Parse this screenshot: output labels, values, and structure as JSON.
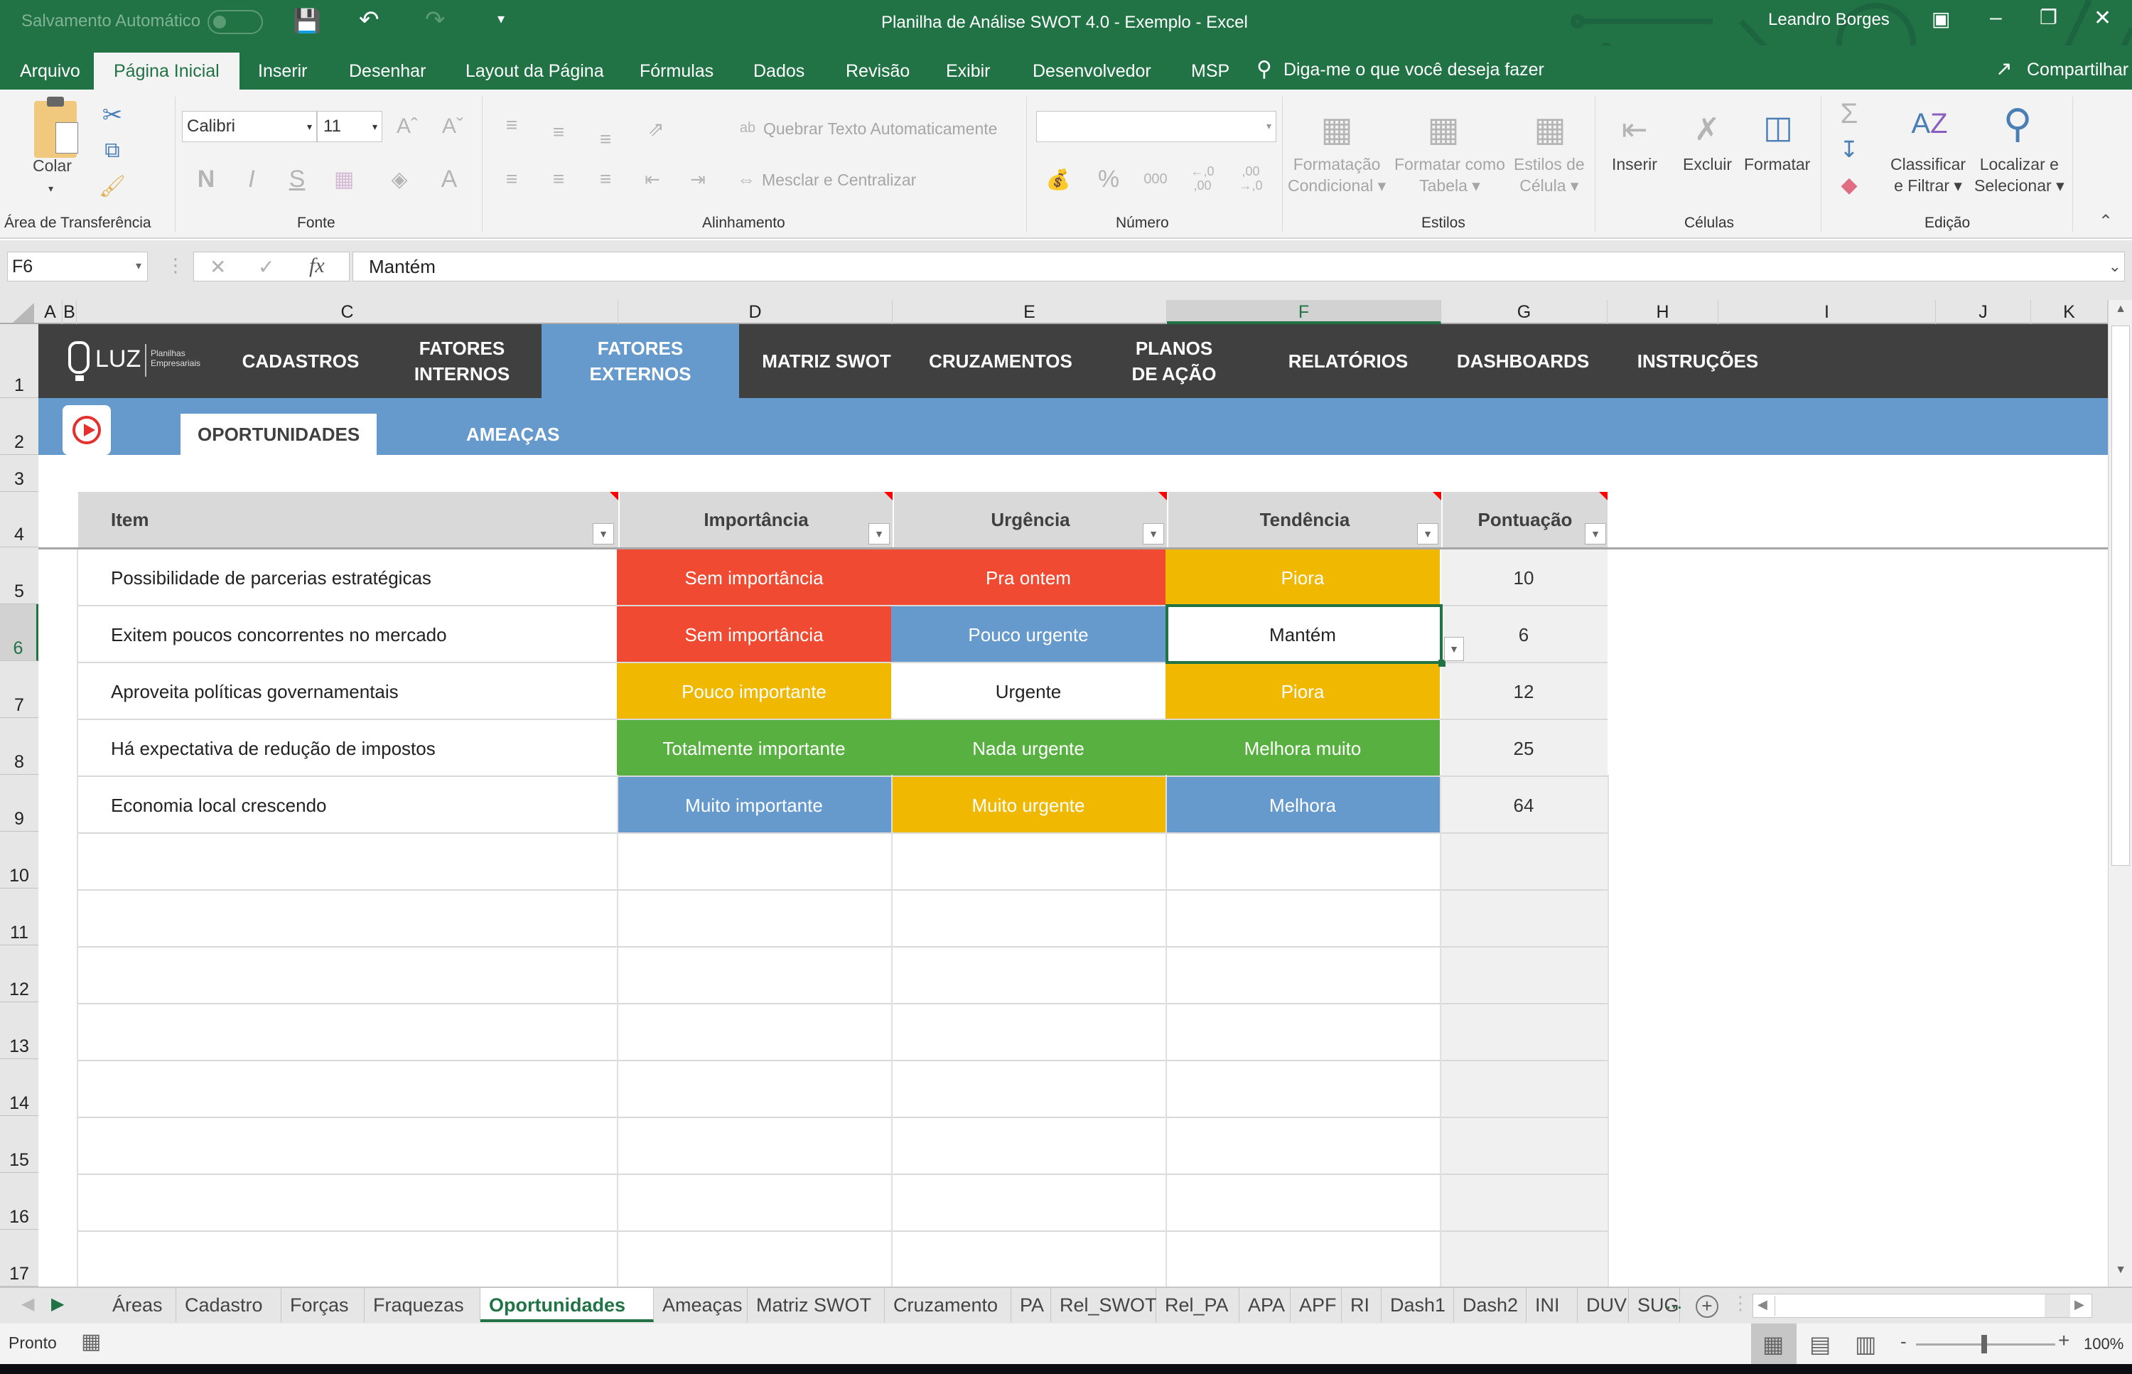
{
  "titlebar": {
    "autosave_label": "Salvamento Automático",
    "autosave_state": "off",
    "title": "Planilha de Análise SWOT 4.0 - Exemplo  -  Excel",
    "user": "Leandro Borges"
  },
  "ribbon_tabs": [
    "Arquivo",
    "Página Inicial",
    "Inserir",
    "Desenhar",
    "Layout da Página",
    "Fórmulas",
    "Dados",
    "Revisão",
    "Exibir",
    "Desenvolvedor",
    "MSP"
  ],
  "ribbon_active_tab": "Página Inicial",
  "tell_me": "Diga-me o que você deseja fazer",
  "share": "Compartilhar",
  "ribbon": {
    "clipboard": {
      "paste": "Colar",
      "label": "Área de Transferência"
    },
    "font": {
      "name": "Calibri",
      "size": "11",
      "bold": "N",
      "italic": "I",
      "underline": "S",
      "label": "Fonte"
    },
    "alignment": {
      "wrap": "Quebrar Texto Automaticamente",
      "merge": "Mesclar e Centralizar",
      "label": "Alinhamento"
    },
    "number": {
      "format": "",
      "percent": "%",
      "thousands": "000",
      "inc_dec": "←,0 ,00",
      "dec_dec": ",00 →,0",
      "label": "Número"
    },
    "styles": {
      "conditional": [
        "Formatação",
        "Condicional"
      ],
      "table": [
        "Formatar como",
        "Tabela"
      ],
      "cell": [
        "Estilos de",
        "Célula"
      ],
      "label": "Estilos"
    },
    "cells": {
      "insert": "Inserir",
      "delete": "Excluir",
      "format": "Formatar",
      "label": "Células"
    },
    "editing": {
      "sort": [
        "Classificar",
        "e Filtrar"
      ],
      "find": [
        "Localizar e",
        "Selecionar"
      ],
      "label": "Edição"
    }
  },
  "formula_bar": {
    "name_box": "F6",
    "fx": "fx",
    "value": "Mantém"
  },
  "columns": [
    "A",
    "B",
    "C",
    "D",
    "E",
    "F",
    "G",
    "H",
    "I",
    "J",
    "K"
  ],
  "selected_column": "F",
  "rows": [
    "1",
    "2",
    "3",
    "4",
    "5",
    "6",
    "7",
    "8",
    "9",
    "10",
    "11",
    "12",
    "13",
    "14",
    "15",
    "16",
    "17"
  ],
  "selected_row": "6",
  "nav": {
    "brand": "LUZ",
    "brand_sub": [
      "Planilhas",
      "Empresariais"
    ],
    "items": [
      {
        "label": "CADASTROS",
        "active": false
      },
      {
        "label": "FATORES\nINTERNOS",
        "active": false
      },
      {
        "label": "FATORES\nEXTERNOS",
        "active": true
      },
      {
        "label": "MATRIZ SWOT",
        "active": false
      },
      {
        "label": "CRUZAMENTOS",
        "active": false
      },
      {
        "label": "PLANOS\nDE AÇÃO",
        "active": false
      },
      {
        "label": "RELATÓRIOS",
        "active": false
      },
      {
        "label": "DASHBOARDS",
        "active": false
      },
      {
        "label": "INSTRUÇÕES",
        "active": false
      }
    ]
  },
  "subtabs": [
    {
      "label": "OPORTUNIDADES",
      "active": true
    },
    {
      "label": "AMEAÇAS",
      "active": false
    }
  ],
  "table": {
    "headers": [
      "Item",
      "Importância",
      "Urgência",
      "Tendência",
      "Pontuação"
    ],
    "rows": [
      {
        "item": "Possibilidade de parcerias estratégicas",
        "importancia": "Sem importância",
        "urgencia": "Pra ontem",
        "tendencia": "Piora",
        "pontuacao": "10",
        "colors": [
          "#f04a32",
          "#f04a32",
          "#f0b800"
        ]
      },
      {
        "item": "Exitem poucos concorrentes no mercado",
        "importancia": "Sem importância",
        "urgencia": "Pouco urgente",
        "tendencia": "Mantém",
        "pontuacao": "6",
        "colors": [
          "#f04a32",
          "#6699cc",
          "#ffffff"
        ]
      },
      {
        "item": "Aproveita políticas governamentais",
        "importancia": "Pouco importante",
        "urgencia": "Urgente",
        "tendencia": "Piora",
        "pontuacao": "12",
        "colors": [
          "#f0b800",
          "#ffffff",
          "#f0b800"
        ]
      },
      {
        "item": "Há expectativa de redução de impostos",
        "importancia": "Totalmente importante",
        "urgencia": "Nada urgente",
        "tendencia": "Melhora muito",
        "pontuacao": "25",
        "colors": [
          "#57b03f",
          "#57b03f",
          "#57b03f"
        ]
      },
      {
        "item": "Economia local crescendo",
        "importancia": "Muito importante",
        "urgencia": "Muito urgente",
        "tendencia": "Melhora",
        "pontuacao": "64",
        "colors": [
          "#6699cc",
          "#f0b800",
          "#6699cc"
        ]
      }
    ]
  },
  "sheet_tabs": [
    "Áreas",
    "Cadastro",
    "Forças",
    "Fraquezas",
    "Oportunidades",
    "Ameaças",
    "Matriz SWOT",
    "Cruzamento",
    "PA",
    "Rel_SWOT",
    "Rel_PA",
    "APA",
    "APF",
    "RI",
    "Dash1",
    "Dash2",
    "INI",
    "DUV",
    "SUG"
  ],
  "active_sheet": "Oportunidades",
  "more_sheets": "...",
  "status": {
    "text": "Pronto",
    "zoom": "100%"
  },
  "colors": {
    "excel_green": "#217346",
    "nav_dark": "#404040",
    "nav_blue": "#6699cc"
  }
}
